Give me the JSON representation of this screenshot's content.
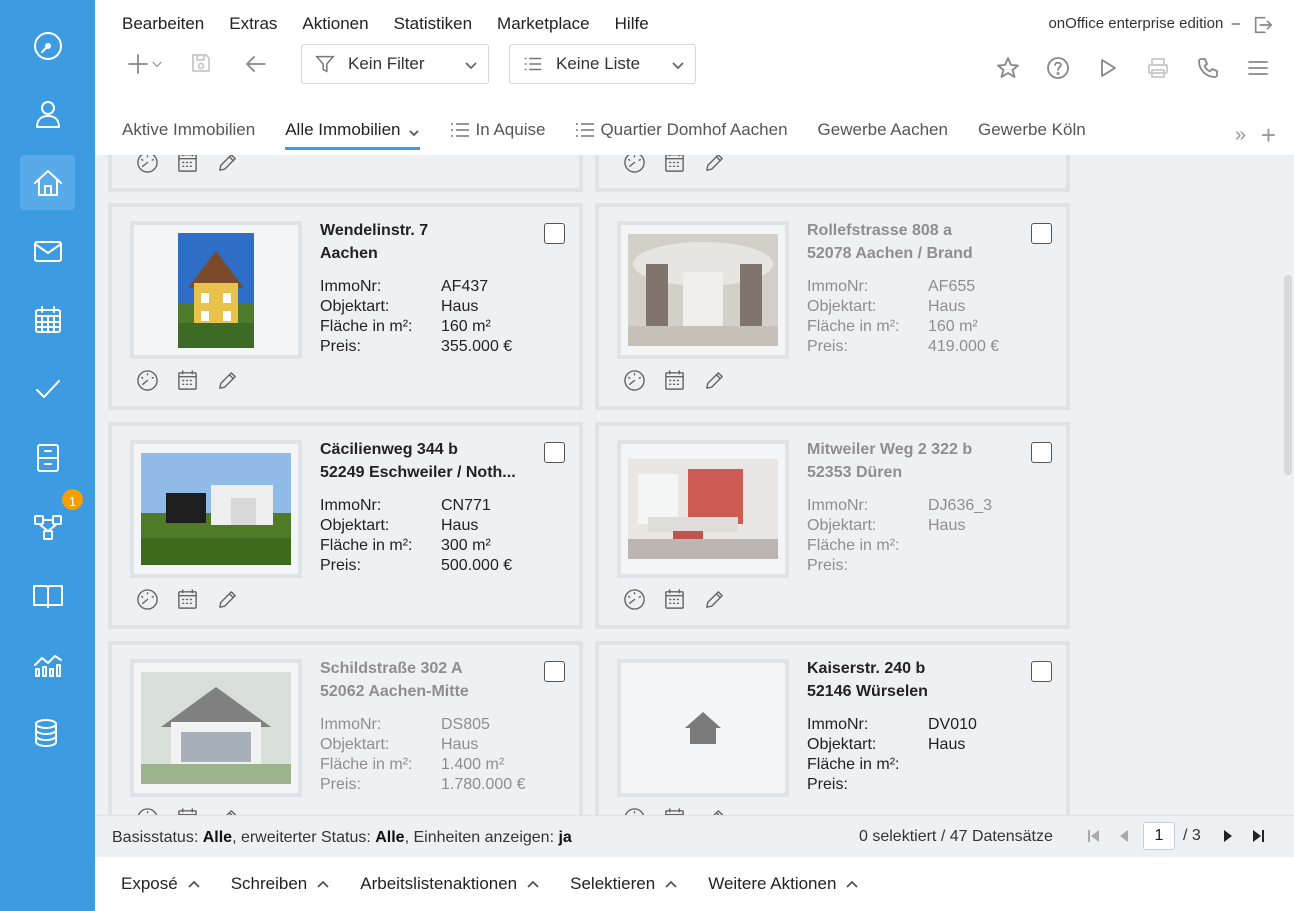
{
  "menu": [
    "Bearbeiten",
    "Extras",
    "Aktionen",
    "Statistiken",
    "Marketplace",
    "Hilfe"
  ],
  "edition": "onOffice enterprise edition",
  "edition_sep": "–",
  "filter": {
    "label": "Kein Filter"
  },
  "list": {
    "label": "Keine Liste"
  },
  "sidebar": {
    "badge": "1"
  },
  "tabs": [
    {
      "label": "Aktive Immobilien"
    },
    {
      "label": "Alle Immobilien"
    },
    {
      "label": "In Aquise"
    },
    {
      "label": "Quartier Domhof Aachen"
    },
    {
      "label": "Gewerbe Aachen"
    },
    {
      "label": "Gewerbe Köln"
    }
  ],
  "tabs_more": "»",
  "tabs_add": "+",
  "field_labels": {
    "immonr": "ImmoNr:",
    "objektart": "Objektart:",
    "flaeche": "Fläche in m²:",
    "preis": "Preis:"
  },
  "cards": [
    {
      "street": "Wendelinstr. 7",
      "city": "Aachen",
      "immonr": "AF437",
      "objektart": "Haus",
      "flaeche": "160 m²",
      "preis": "355.000 €"
    },
    {
      "street": "Rollefstrasse 808 a",
      "city": "52078 Aachen / Brand",
      "immonr": "AF655",
      "objektart": "Haus",
      "flaeche": "160 m²",
      "preis": "419.000 €"
    },
    {
      "street": "Cäcilienweg 344 b",
      "city": "52249 Eschweiler / Noth...",
      "immonr": "CN771",
      "objektart": "Haus",
      "flaeche": "300 m²",
      "preis": "500.000 €"
    },
    {
      "street": "Mitweiler Weg 2 322 b",
      "city": "52353 Düren",
      "immonr": "DJ636_3",
      "objektart": "Haus",
      "flaeche": "",
      "preis": ""
    },
    {
      "street": "Schildstraße 302 A",
      "city": "52062 Aachen-Mitte",
      "immonr": "DS805",
      "objektart": "Haus",
      "flaeche": "1.400 m²",
      "preis": "1.780.000 €"
    },
    {
      "street": "Kaiserstr. 240 b",
      "city": "52146 Würselen",
      "immonr": "DV010",
      "objektart": "Haus",
      "flaeche": "",
      "preis": ""
    }
  ],
  "status": {
    "basis_label": "Basisstatus:",
    "basis_value": "Alle",
    "erw_label": ", erweiterter Status:",
    "erw_value": "Alle",
    "einh_label": ", Einheiten anzeigen:",
    "einh_value": "ja",
    "selection": "0 selektiert / 47 Datensätze",
    "page": "1",
    "page_total": "/ 3"
  },
  "actions": [
    "Exposé",
    "Schreiben",
    "Arbeitslistenaktionen",
    "Selektieren",
    "Weitere Aktionen"
  ]
}
